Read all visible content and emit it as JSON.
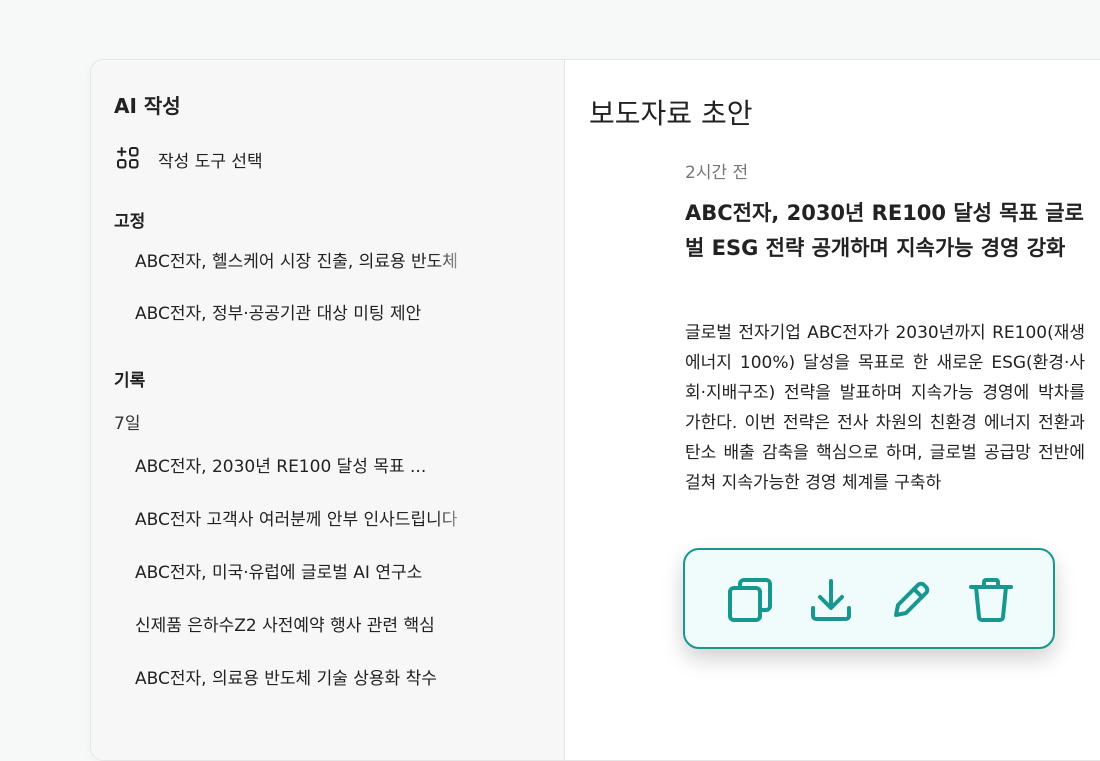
{
  "sidebar": {
    "title": "AI 작성",
    "tool_select_label": "작성 도구 선택",
    "pinned_label": "고정",
    "pinned_items": [
      "ABC전자, 헬스케어 시장 진출, 의료용 반도체",
      "ABC전자, 정부·공공기관 대상 미팅 제안"
    ],
    "history_label": "기록",
    "history_group_label": "7일",
    "history_items": [
      "ABC전자, 2030년 RE100 달성 목표 ...",
      "ABC전자 고객사 여러분께 안부 인사드립니다",
      "ABC전자, 미국·유럽에 글로벌 AI 연구소",
      "신제품 은하수Z2 사전예약 행사 관련 핵심",
      "ABC전자, 의료용 반도체 기술 상용화 착수"
    ]
  },
  "main": {
    "title": "보도자료 초안",
    "timestamp": "2시간 전",
    "headline": "ABC전자, 2030년 RE100 달성 목표 글로벌 ESG 전략 공개하며 지속가능 경영 강화",
    "body": "글로벌 전자기업 ABC전자가 2030년까지 RE100(재생에너지 100%) 달성을 목표로 한 새로운 ESG(환경·사회·지배구조) 전략을 발표하며 지속가능 경영에 박차를 가한다. 이번 전략은 전사 차원의 친환경 에너지 전환과 탄소 배출 감축을 핵심으로 하며, 글로벌 공급망 전반에 걸쳐 지속가능한 경영 체계를 구축하"
  },
  "action_bar": {
    "buttons": [
      {
        "icon": "copy-icon"
      },
      {
        "icon": "download-icon"
      },
      {
        "icon": "edit-icon"
      },
      {
        "icon": "trash-icon"
      }
    ]
  },
  "colors": {
    "accent": "#16978f",
    "action_bar_bg": "#f0fbfb",
    "sidebar_bg": "#f7f7f7",
    "page_bg": "#f7f8f8"
  }
}
